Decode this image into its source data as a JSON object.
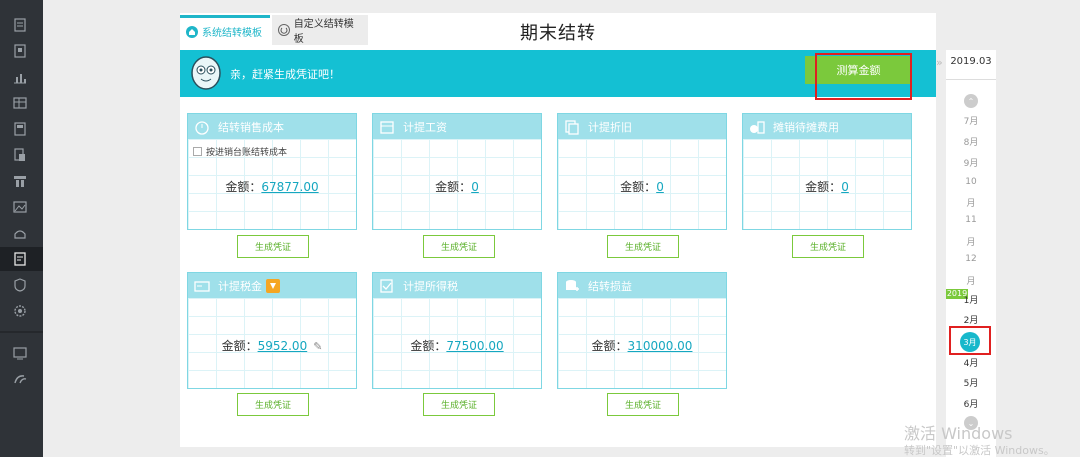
{
  "sidebar": {
    "icons": [
      "document-icon",
      "ledger-icon",
      "chart-icon",
      "report-icon",
      "calculator-icon",
      "voucher-icon",
      "inventory-icon",
      "picture-icon",
      "hand-icon",
      "settlement-icon",
      "shield-icon",
      "settings-icon",
      "monitor-icon",
      "logout-icon"
    ]
  },
  "tabs": [
    {
      "label": "系统结转模板"
    },
    {
      "label": "自定义结转模板"
    }
  ],
  "title": "期末结转",
  "banner": {
    "message": "亲，赶紧生成凭证吧！",
    "calc_button": "测算金额"
  },
  "cards": [
    {
      "title": "结转销售成本",
      "checkbox": "按进销台账结转成本",
      "amount_label": "金额：",
      "amount": "67877.00",
      "button": "生成凭证"
    },
    {
      "title": "计提工资",
      "amount_label": "金额：",
      "amount": "0",
      "button": "生成凭证"
    },
    {
      "title": "计提折旧",
      "amount_label": "金额：",
      "amount": "0",
      "button": "生成凭证"
    },
    {
      "title": "摊销待摊费用",
      "amount_label": "金额：",
      "amount": "0",
      "button": "生成凭证"
    },
    {
      "title": "计提税金",
      "amount_label": "金额：",
      "amount": "5952.00",
      "button": "生成凭证"
    },
    {
      "title": "计提所得税",
      "amount_label": "金额：",
      "amount": "77500.00",
      "button": "生成凭证"
    },
    {
      "title": "结转损益",
      "amount_label": "金额：",
      "amount": "310000.00",
      "button": "生成凭证"
    }
  ],
  "timeline": {
    "top_year": "2019.03",
    "months_prev": [
      "7月",
      "8月",
      "9月",
      "10",
      "月",
      "11",
      "月",
      "12",
      "月"
    ],
    "year_badge": "2019",
    "months_next": [
      "1月",
      "2月"
    ],
    "current": "3月",
    "months_after": [
      "4月",
      "5月",
      "6月"
    ]
  },
  "watermark": {
    "line1": "激活 Windows",
    "line2": "转到\"设置\"以激活 Windows。"
  },
  "colors": {
    "accent": "#14c0d3",
    "green": "#7bc93c",
    "sidebar": "#2f3338"
  }
}
